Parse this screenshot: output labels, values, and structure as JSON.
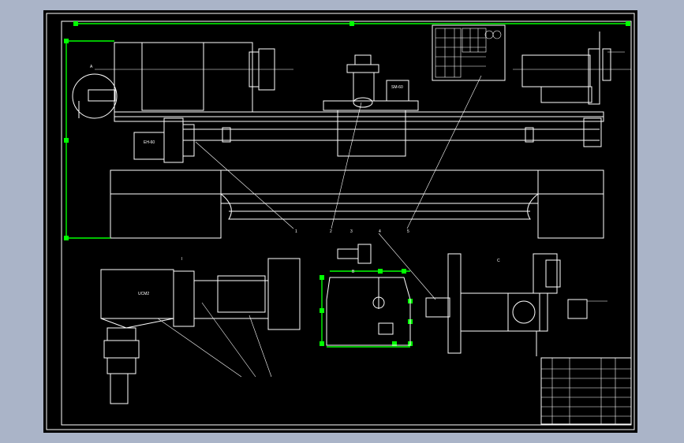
{
  "drawing": {
    "background": "#000000",
    "viewport_background": "#aab4c8",
    "line_color": "#ffffff",
    "selection_color": "#00ff00",
    "view_labels": {
      "view_i": "I",
      "view_b": "B",
      "view_c": "C",
      "detail_a": "A"
    },
    "leader_numbers": [
      "1",
      "2",
      "3",
      "4",
      "5"
    ],
    "motor_label_left": "EH-60",
    "motor_label_top": "SM-60",
    "section_label": "UCM2"
  }
}
